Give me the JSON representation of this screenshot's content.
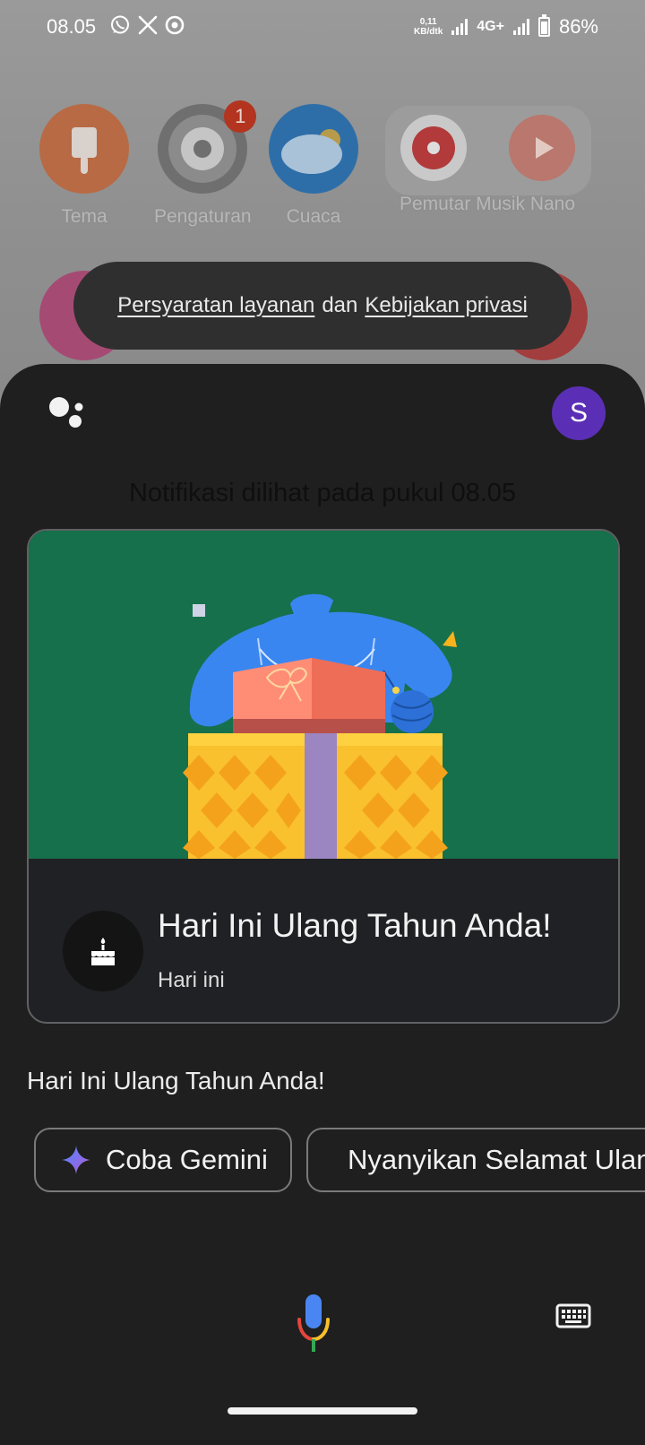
{
  "status_bar": {
    "time": "08.05",
    "net_speed_value": "0,11",
    "net_speed_unit": "KB/dtk",
    "network_type": "4G+",
    "battery": "86%",
    "notification_icons": [
      "whatsapp-icon",
      "x-icon",
      "record-icon"
    ]
  },
  "home_screen": {
    "apps": [
      {
        "label": "Tema",
        "icon": "paint-brush-icon",
        "color": "#c46a3e"
      },
      {
        "label": "Pengaturan",
        "icon": "gear-icon",
        "color": "#7a7a7a",
        "badge": "1"
      },
      {
        "label": "Cuaca",
        "icon": "weather-icon",
        "color": "#2a6aa6"
      },
      {
        "label": "Pemutar Musik Nano",
        "icon": "music-player-icon",
        "color": "#b64a4a"
      }
    ]
  },
  "toast": {
    "terms_link": "Persyaratan layanan",
    "joiner": "dan",
    "privacy_link": "Kebijakan privasi"
  },
  "assistant": {
    "avatar_letter": "S",
    "seen_text": "Notifikasi dilihat pada pukul 08.05",
    "card": {
      "title": "Hari Ini Ulang Tahun Anda!",
      "subtitle": "Hari ini",
      "hero_bg": "#16704c"
    },
    "response_text": "Hari Ini Ulang Tahun Anda!",
    "chips": [
      {
        "label": "Coba Gemini",
        "icon": "gemini-sparkle-icon"
      },
      {
        "label": "Nyanyikan Selamat Ulang Tahun",
        "icon": "music-note-icon"
      }
    ]
  }
}
